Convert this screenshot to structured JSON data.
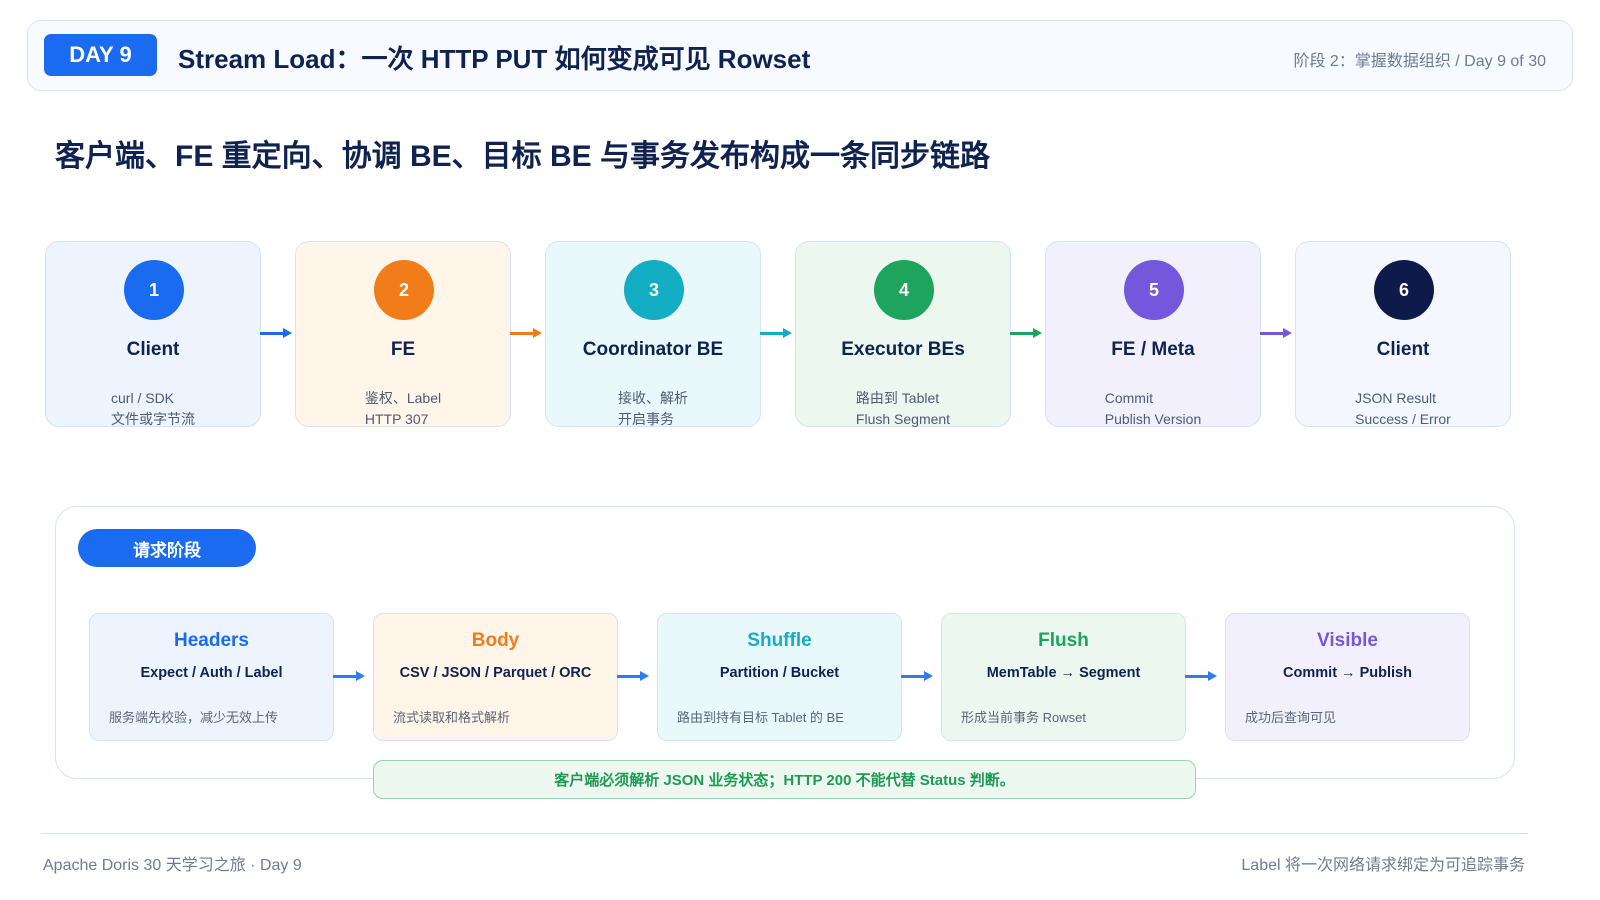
{
  "header": {
    "day_badge": "DAY 9",
    "title": "Stream Load：一次 HTTP PUT 如何变成可见 Rowset",
    "meta": "阶段 2：掌握数据组织 / Day 9 of 30"
  },
  "subtitle": "客户端、FE 重定向、协调 BE、目标 BE 与事务发布构成一条同步链路",
  "flow": [
    {
      "num": "1",
      "name": "Client",
      "desc1": "curl / SDK",
      "desc2": "文件或字节流",
      "bg": "#eef4fe",
      "accent": "#1a6bf0"
    },
    {
      "num": "2",
      "name": "FE",
      "desc1": "鉴权、Label",
      "desc2": "HTTP 307",
      "bg": "#fff5e8",
      "accent": "#f07c1a"
    },
    {
      "num": "3",
      "name": "Coordinator BE",
      "desc1": "接收、解析",
      "desc2": "开启事务",
      "bg": "#e9f8fb",
      "accent": "#14aec4"
    },
    {
      "num": "4",
      "name": "Executor BEs",
      "desc1": "路由到 Tablet",
      "desc2": "Flush Segment",
      "bg": "#ecf7f0",
      "accent": "#1fa45e"
    },
    {
      "num": "5",
      "name": "FE / Meta",
      "desc1": "Commit",
      "desc2": "Publish Version",
      "bg": "#f3f0fd",
      "accent": "#7357dc"
    },
    {
      "num": "6",
      "name": "Client",
      "desc1": "JSON Result",
      "desc2": "Success / Error",
      "bg": "#f4f8fe",
      "accent": "#0e1a4a"
    }
  ],
  "phase": {
    "label": "请求阶段",
    "stages": [
      {
        "title": "Headers",
        "sub": "Expect / Auth / Label",
        "note": "服务端先校验，减少无效上传",
        "bg": "#eef4fe",
        "color": "#1a6bf0"
      },
      {
        "title": "Body",
        "sub": "CSV / JSON / Parquet / ORC",
        "note": "流式读取和格式解析",
        "bg": "#fff5e8",
        "color": "#f07c1a"
      },
      {
        "title": "Shuffle",
        "sub": "Partition / Bucket",
        "note": "路由到持有目标 Tablet 的 BE",
        "bg": "#e9f8fb",
        "color": "#14aec4"
      },
      {
        "title": "Flush",
        "sub": "MemTable → Segment",
        "note": "形成当前事务 Rowset",
        "bg": "#ecf7f0",
        "color": "#1fa45e"
      },
      {
        "title": "Visible",
        "sub": "Commit → Publish",
        "note": "成功后查询可见",
        "bg": "#f3f0fd",
        "color": "#7357dc"
      }
    ],
    "notice": "客户端必须解析 JSON 业务状态；HTTP 200 不能代替 Status 判断。"
  },
  "footer": {
    "left": "Apache Doris 30 天学习之旅 · Day 9",
    "right": "Label 将一次网络请求绑定为可追踪事务"
  }
}
